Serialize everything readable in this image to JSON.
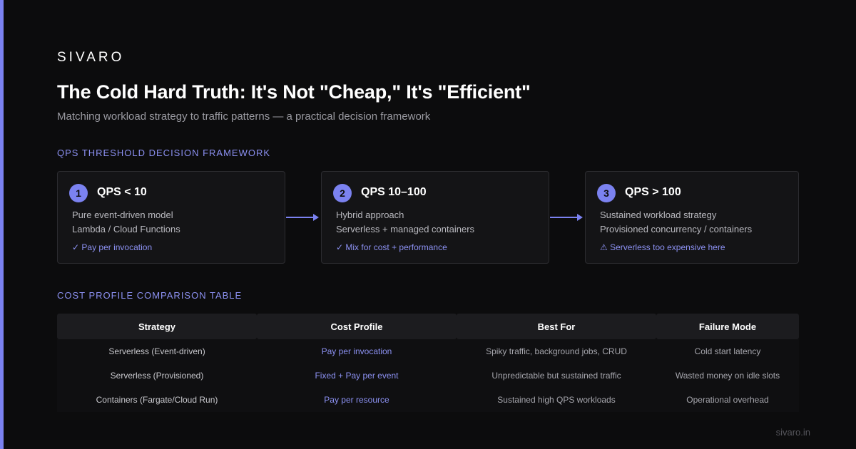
{
  "brand": "SIVARO",
  "title": "The Cold Hard Truth: It's Not \"Cheap,\" It's \"Efficient\"",
  "subtitle": "Matching workload strategy to traffic patterns — a practical decision framework",
  "framework": {
    "label": "QPS THRESHOLD DECISION FRAMEWORK",
    "cards": [
      {
        "step": "1",
        "heading": "QPS < 10",
        "line1": "Pure event-driven model",
        "line2": "Lambda / Cloud Functions",
        "note": "✓ Pay per invocation"
      },
      {
        "step": "2",
        "heading": "QPS 10–100",
        "line1": "Hybrid approach",
        "line2": "Serverless + managed containers",
        "note": "✓ Mix for cost + performance"
      },
      {
        "step": "3",
        "heading": "QPS > 100",
        "line1": "Sustained workload strategy",
        "line2": "Provisioned concurrency / containers",
        "note": "⚠ Serverless too expensive here"
      }
    ]
  },
  "table": {
    "label": "COST PROFILE COMPARISON TABLE",
    "headers": [
      "Strategy",
      "Cost Profile",
      "Best For",
      "Failure Mode"
    ],
    "rows": [
      [
        "Serverless (Event-driven)",
        "Pay per invocation",
        "Spiky traffic, background jobs, CRUD",
        "Cold start latency"
      ],
      [
        "Serverless (Provisioned)",
        "Fixed + Pay per event",
        "Unpredictable but sustained traffic",
        "Wasted money on idle slots"
      ],
      [
        "Containers (Fargate/Cloud Run)",
        "Pay per resource",
        "Sustained high QPS workloads",
        "Operational overhead"
      ]
    ]
  },
  "footer": "sivaro.in",
  "colors": {
    "accent": "#7b82f0",
    "background": "#0c0c0d",
    "card": "#141416"
  }
}
